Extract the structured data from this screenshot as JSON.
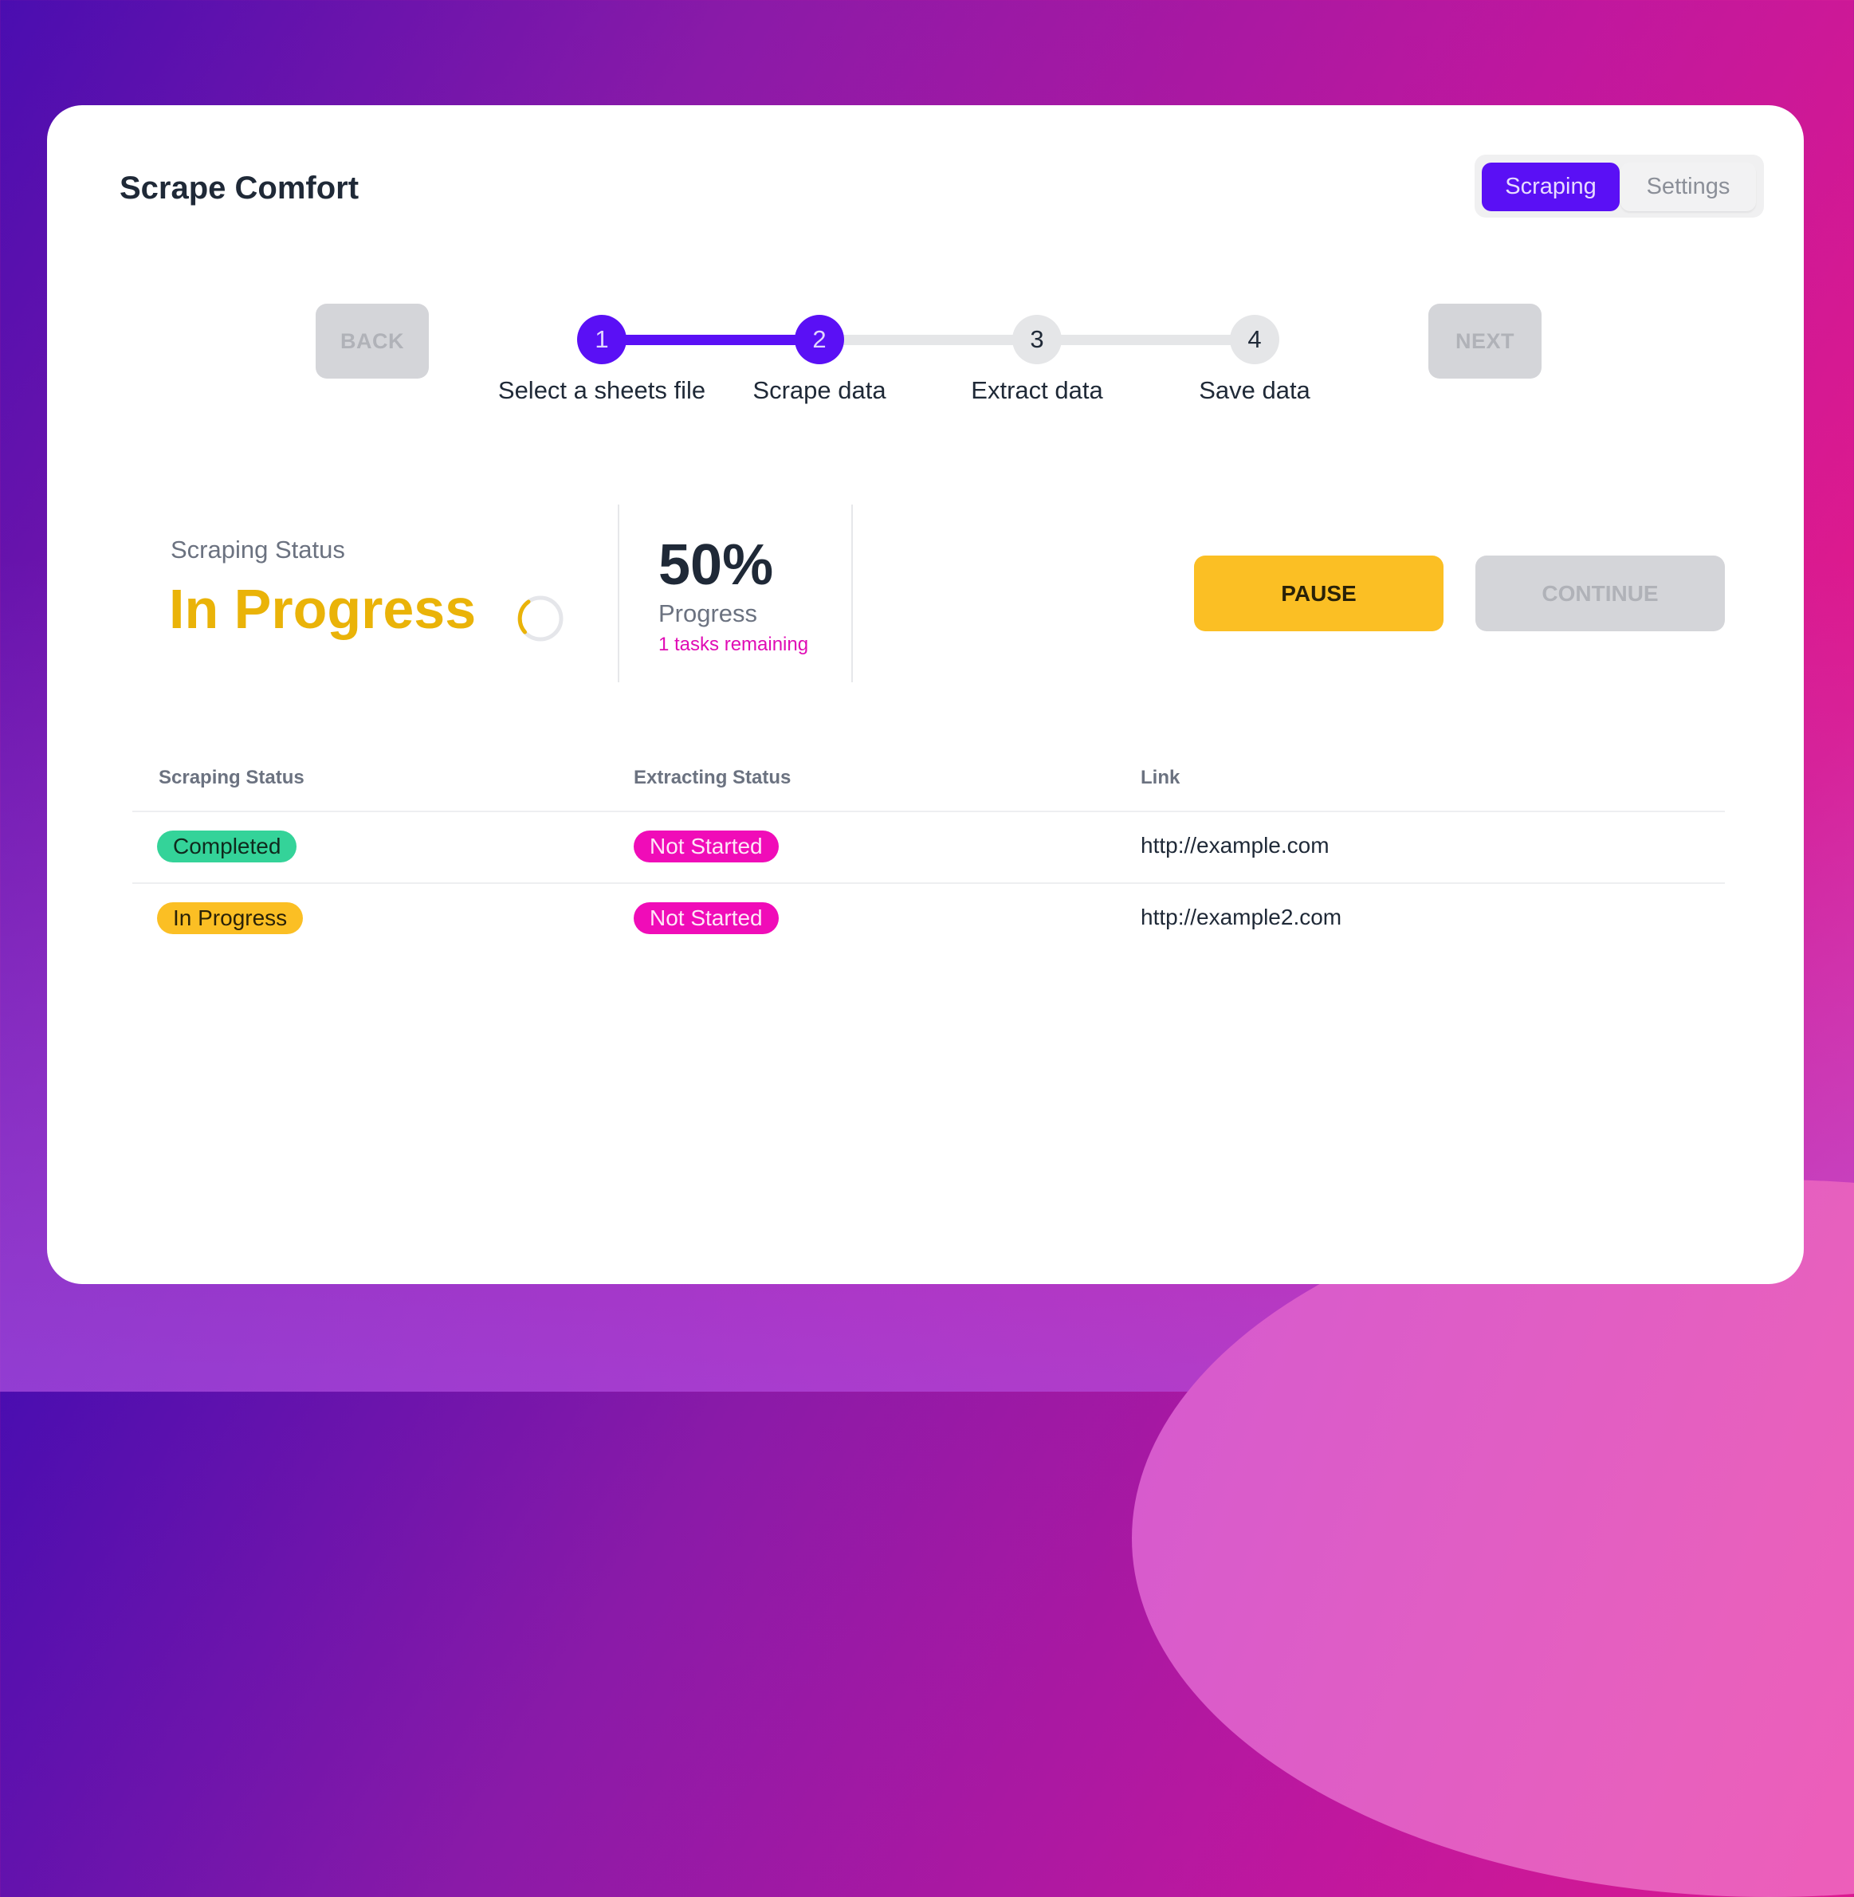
{
  "app": {
    "title": "Scrape Comfort"
  },
  "tabs": [
    {
      "label": "Scraping",
      "active": true
    },
    {
      "label": "Settings",
      "active": false
    }
  ],
  "stepper": {
    "back_label": "BACK",
    "next_label": "NEXT",
    "current_step": 2,
    "steps": [
      {
        "number": "1",
        "label": "Select a sheets file",
        "state": "done"
      },
      {
        "number": "2",
        "label": "Scrape data",
        "state": "current"
      },
      {
        "number": "3",
        "label": "Extract data",
        "state": "todo"
      },
      {
        "number": "4",
        "label": "Save data",
        "state": "todo"
      }
    ]
  },
  "status": {
    "label": "Scraping Status",
    "value": "In Progress",
    "spinner_icon": "loading-spinner-icon"
  },
  "progress": {
    "percent_text": "50%",
    "percent": 50,
    "label": "Progress",
    "remaining": "1 tasks remaining"
  },
  "actions": {
    "pause_label": "PAUSE",
    "continue_label": "CONTINUE"
  },
  "table": {
    "headers": [
      "Scraping Status",
      "Extracting Status",
      "Link"
    ],
    "rows": [
      {
        "scraping": "Completed",
        "extracting": "Not Started",
        "link": "http://example.com"
      },
      {
        "scraping": "In Progress",
        "extracting": "Not Started",
        "link": "http://example2.com"
      }
    ]
  },
  "colors": {
    "primary": "#5a10f5",
    "warning": "#fbbf24",
    "status_text": "#eab308",
    "success": "#34d399",
    "magenta": "#f00cb8",
    "disabled": "#d4d5d9"
  }
}
